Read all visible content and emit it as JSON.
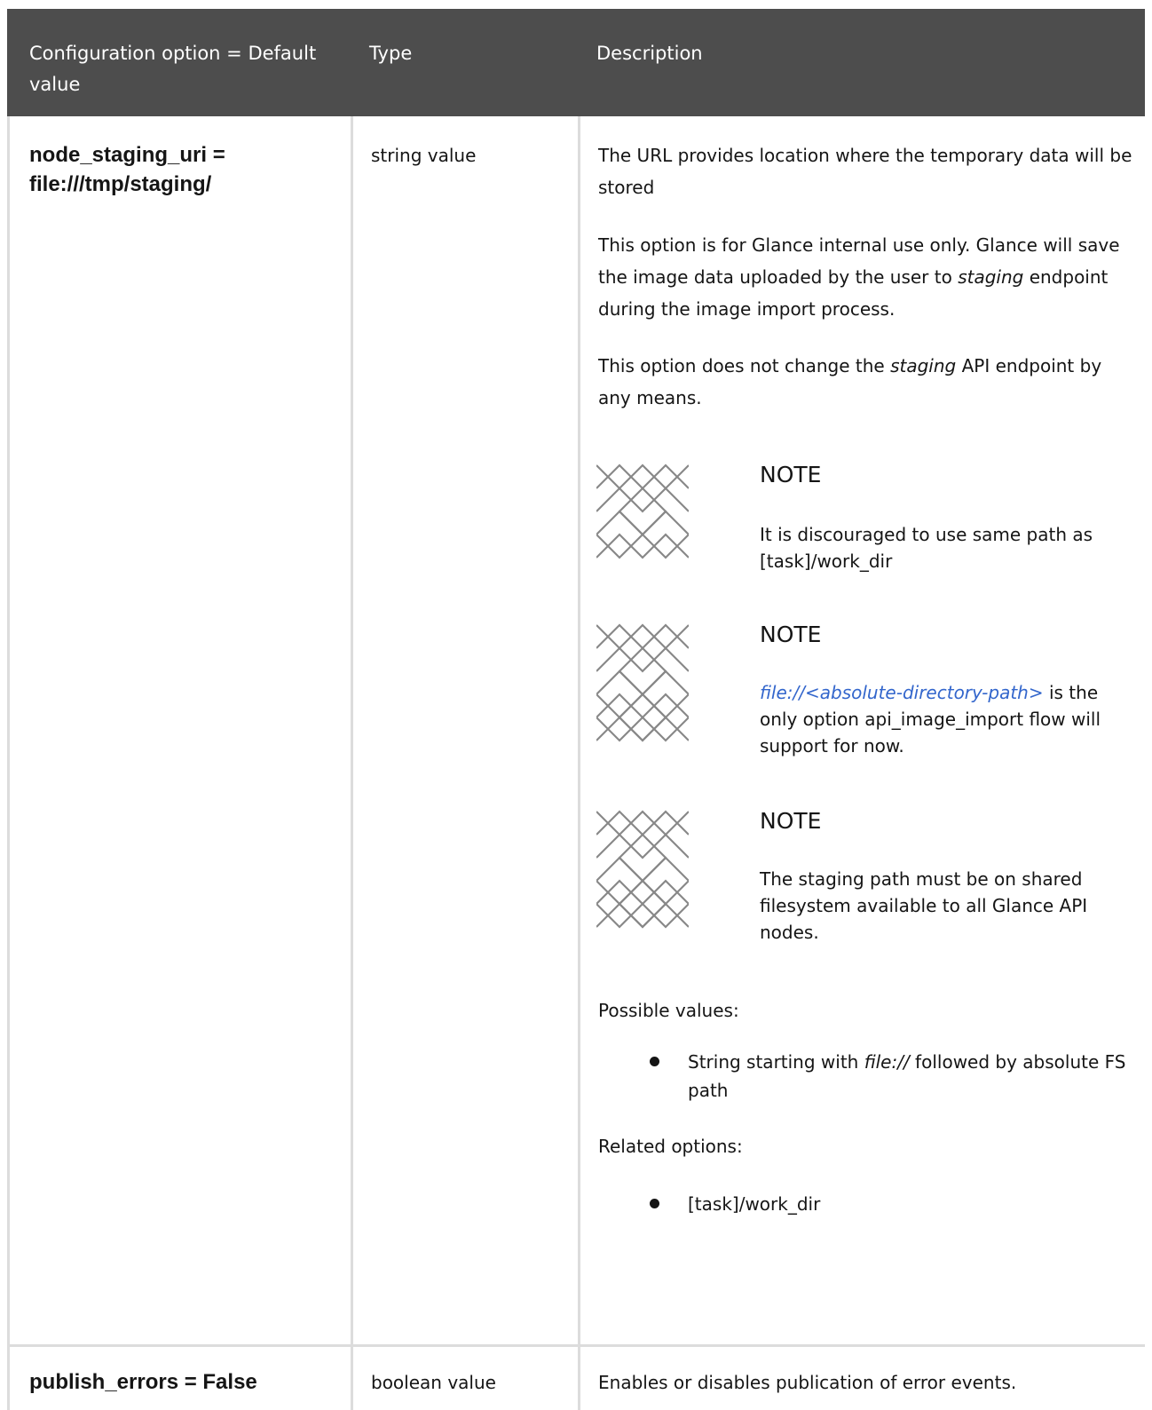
{
  "header": {
    "col_option": "Configuration option = Default value",
    "col_type": "Type",
    "col_description": "Description"
  },
  "rows": [
    {
      "option_line1": "node_staging_uri =",
      "option_line2": "file:///tmp/staging/",
      "type": "string value",
      "desc_p1": "The URL provides location where the temporary data will be stored",
      "desc_p2_a": "This option is for Glance internal use only. Glance will save the image data uploaded by the user to ",
      "desc_p2_em": "staging",
      "desc_p2_b": " endpoint during the image import process.",
      "desc_p3_a": "This option does not change the ",
      "desc_p3_em": "staging",
      "desc_p3_b": " API endpoint by any means.",
      "notes": [
        {
          "title": "NOTE",
          "body": "It is discouraged to use same path as [task]/work_dir"
        },
        {
          "title": "NOTE",
          "link": "file://<absolute-directory-path>",
          "body": " is the only option api_image_import flow will support for now."
        },
        {
          "title": "NOTE",
          "body": "The staging path must be on shared filesystem available to all Glance API nodes."
        }
      ],
      "possible_values_label": "Possible values:",
      "possible_values_item_a": "String starting with ",
      "possible_values_item_em": "file://",
      "possible_values_item_b": " followed by absolute FS path",
      "related_label": "Related options:",
      "related_item": "[task]/work_dir"
    },
    {
      "option": "publish_errors = False",
      "type": "boolean value",
      "description": "Enables or disables publication of error events."
    }
  ],
  "icons": {
    "note": "note-pattern-icon"
  },
  "colors": {
    "header_bg": "#4d4d4d",
    "link": "#3366cc",
    "grid": "#dcdcdc"
  }
}
